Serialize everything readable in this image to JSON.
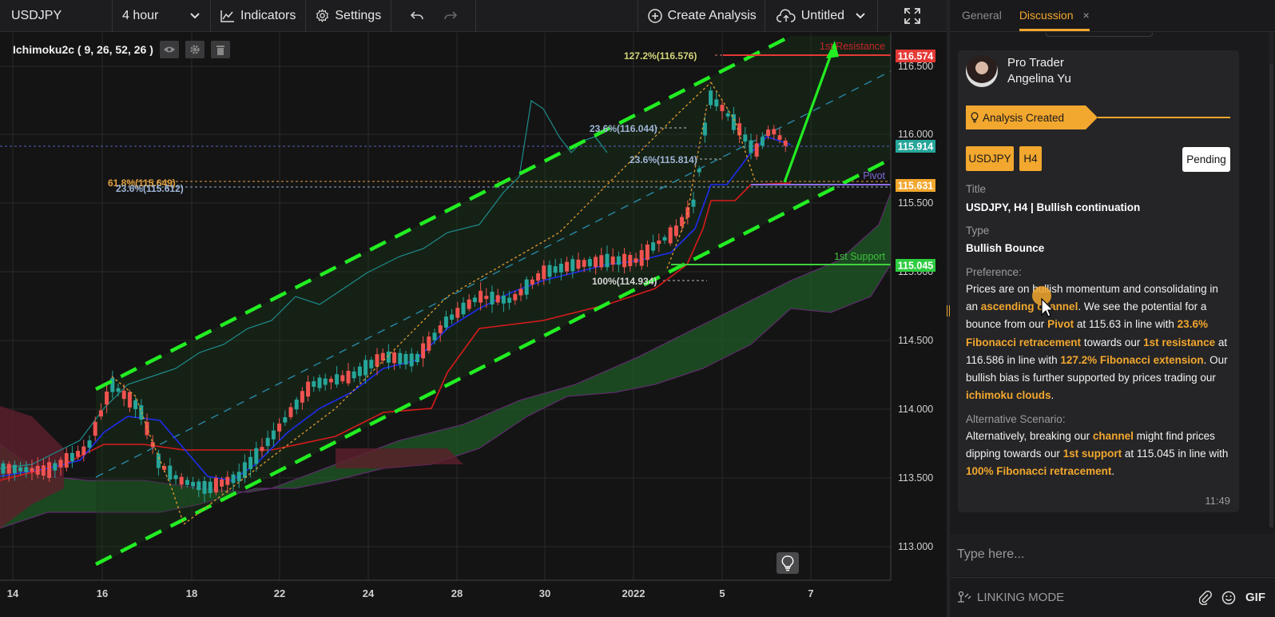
{
  "toolbar": {
    "symbol": "USDJPY",
    "interval": "4 hour",
    "indicators_label": "Indicators",
    "settings_label": "Settings",
    "create_analysis_label": "Create Analysis",
    "layout_name": "Untitled"
  },
  "chart": {
    "indicator_label": "Ichimoku2c ( 9, 26, 52, 26 )",
    "price_axis": [
      "116.500",
      "116.000",
      "115.500",
      "115.000",
      "114.500",
      "114.000",
      "113.500",
      "113.000"
    ],
    "time_axis": [
      "14",
      "16",
      "18",
      "22",
      "24",
      "28",
      "30",
      "2022",
      "5",
      "7"
    ],
    "price_tags": {
      "resistance": {
        "value": "116.574",
        "color": "#e53935"
      },
      "current": {
        "value": "115.914",
        "color": "#26a69a"
      },
      "pivot": {
        "value": "115.631",
        "color": "#f2a72e"
      },
      "support": {
        "value": "115.045",
        "color": "#2ecc40"
      }
    },
    "line_labels": {
      "resistance": "1st Resistance",
      "pivot": "Pivot",
      "support": "1st Support"
    },
    "fib_labels": {
      "ext_1272": "127.2%(116.576)",
      "ret_236_a": "23.6%(116.044)",
      "ret_236_b": "23.6%(115.814)",
      "ret_618": "61.8%(115.649)",
      "ret_236_c": "23.6%(115.612)",
      "ret_100": "100%(114.934)"
    },
    "colors": {
      "channel": "#22ee22",
      "arrow": "#22ee22",
      "tenkan": "#2030ff",
      "kijun": "#e02020",
      "chikou": "#20a0a0",
      "cloud": "#2e7d32",
      "bull_candle": "#26a69a",
      "bear_candle": "#ef5350"
    }
  },
  "panel": {
    "tabs": [
      "General",
      "Discussion"
    ],
    "author_role": "Pro Trader",
    "author_name": "Angelina Yu",
    "status_ribbon": "Analysis Created",
    "badge_symbol": "USDJPY",
    "badge_interval": "H4",
    "badge_status": "Pending",
    "title_label": "Title",
    "title_value": "USDJPY, H4 | Bullish continuation",
    "type_label": "Type",
    "type_value": "Bullish Bounce",
    "preference_label": "Preference:",
    "preference": {
      "t1": "Prices are on bullish momentum and consolidating in an ",
      "h1": "ascending channel",
      "t2": ". We see the potential for a bounce from our ",
      "h2": "Pivot",
      "t3": " at 115.63 in line with ",
      "h3": "23.6% Fibonacci retracement",
      "t4": " towards our ",
      "h4": "1st resistance",
      "t5": " at 116.586 in line with ",
      "h5": "127.2% Fibonacci extension",
      "t6": ". Our bullish bias is further supported by prices trading our ",
      "h6": "ichimoku clouds",
      "t7": "."
    },
    "alternative_label": "Alternative Scenario:",
    "alternative": {
      "t1": "Alternatively, breaking our ",
      "h1": "channel",
      "t2": " might find prices dipping towards our ",
      "h2": "1st support",
      "t3": " at 115.045 in line with ",
      "h3": "100% Fibonacci retracement",
      "t4": "."
    },
    "time": "11:49",
    "input_placeholder": "Type here...",
    "linking_mode": "LINKING MODE",
    "gif_label": "GIF"
  }
}
